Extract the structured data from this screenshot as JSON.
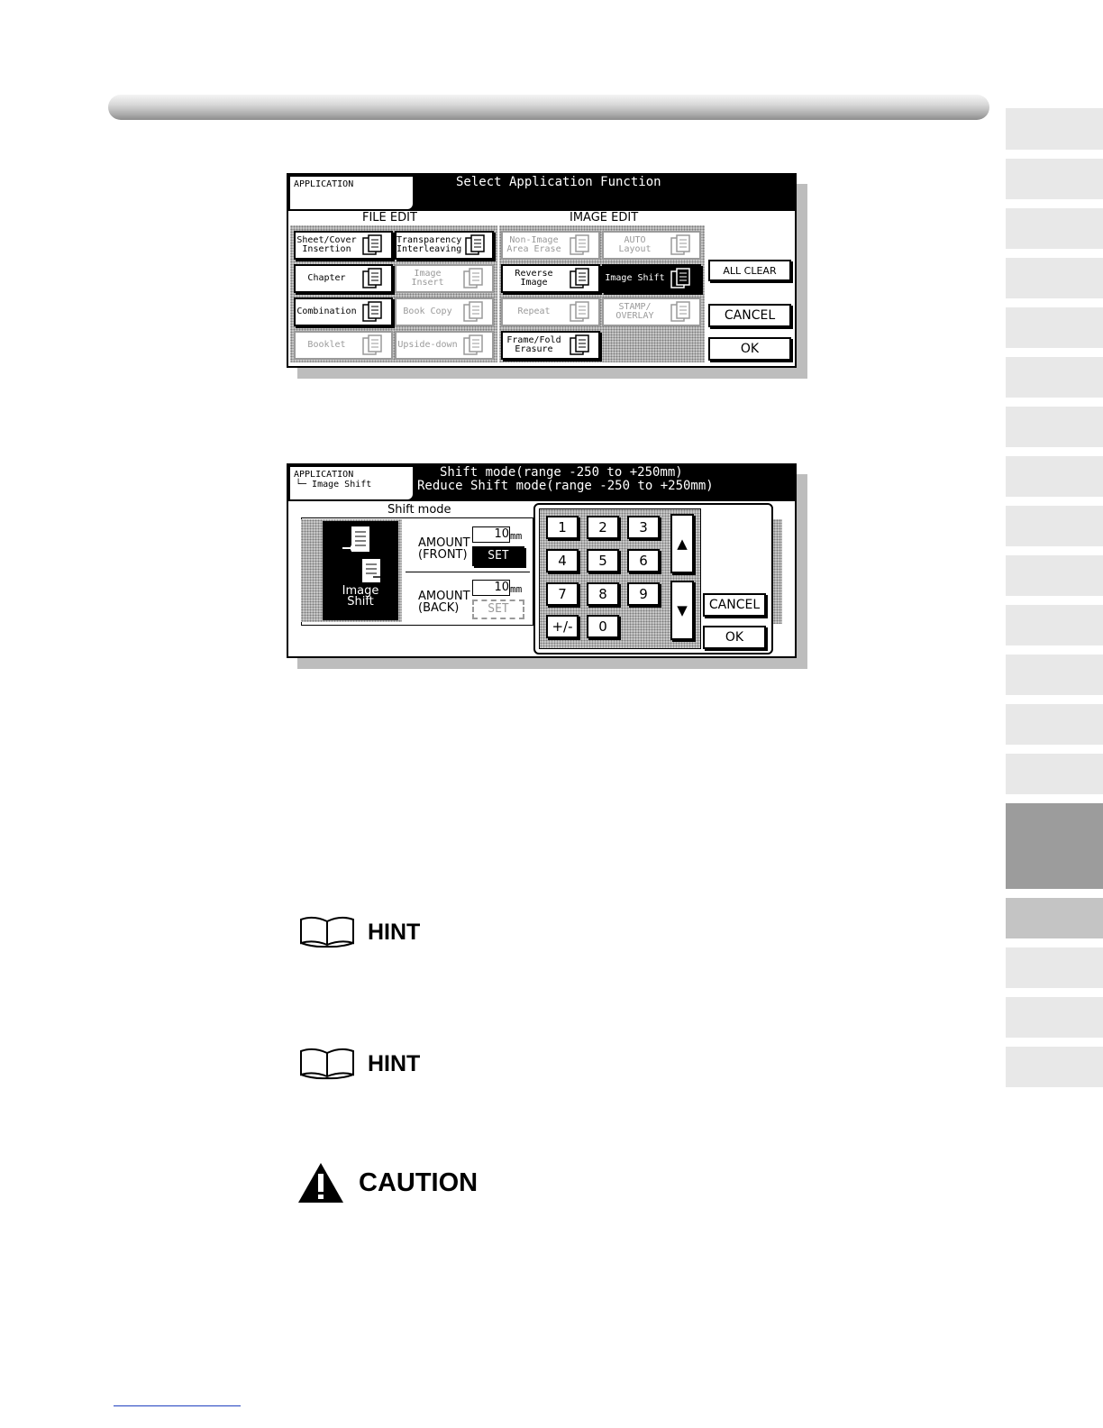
{
  "nav_tabs_count": 20,
  "screen1": {
    "app_label": "APPLICATION",
    "title": "Select Application Function",
    "file_edit_label": "FILE EDIT",
    "image_edit_label": "IMAGE EDIT",
    "file_buttons": [
      {
        "label": "Sheet/Cover\nInsertion",
        "icon": "sheets-stack-icon",
        "enabled": true
      },
      {
        "label": "Transparency\nInterleaving",
        "icon": "transparency-icon",
        "enabled": true
      },
      {
        "label": "Chapter",
        "icon": "chapter-pages-icon",
        "enabled": true
      },
      {
        "label": "Image\nInsert",
        "icon": "image-insert-icon",
        "enabled": false
      },
      {
        "label": "Combination",
        "icon": "combination-grid-icon",
        "enabled": true
      },
      {
        "label": "Book Copy",
        "icon": "book-copy-icon",
        "enabled": false
      },
      {
        "label": "Booklet",
        "icon": "booklet-icon",
        "enabled": false
      },
      {
        "label": "Upside-down",
        "icon": "upside-down-icon",
        "enabled": false
      }
    ],
    "image_buttons": [
      {
        "label": "Non-Image\nArea Erase",
        "icon": "area-erase-icon",
        "enabled": false
      },
      {
        "label": "AUTO\nLayout",
        "icon": "auto-layout-icon",
        "enabled": false
      },
      {
        "label": "Reverse\nImage",
        "icon": "reverse-image-icon",
        "enabled": true
      },
      {
        "label": "Image Shift",
        "icon": "image-shift-icon",
        "enabled": true,
        "selected": true
      },
      {
        "label": "Repeat",
        "icon": "repeat-icon",
        "enabled": false
      },
      {
        "label": "STAMP/\nOVERLAY",
        "icon": "stamp-icon",
        "enabled": false
      },
      {
        "label": "Frame/Fold\nErasure",
        "icon": "frame-erase-icon",
        "enabled": true
      }
    ],
    "all_clear": "ALL CLEAR",
    "cancel": "CANCEL",
    "ok": "OK"
  },
  "screen2": {
    "app_label": "APPLICATION",
    "breadcrumb": "└─ Image Shift",
    "title_line1": "Shift mode(range -250 to +250mm)",
    "title_line2": "Reduce Shift mode(range -250 to +250mm)",
    "mode_label": "Shift mode",
    "image_shift_label": "Image\nShift",
    "front_label": "AMOUNT\n(FRONT)",
    "front_value": "10",
    "back_label": "AMOUNT\n(BACK)",
    "back_value": "10",
    "unit": "mm",
    "set_label": "SET",
    "keys": [
      "1",
      "2",
      "3",
      "4",
      "5",
      "6",
      "7",
      "8",
      "9",
      "+/-",
      "0"
    ],
    "up_arrow": "▲",
    "down_arrow": "▼",
    "cancel": "CANCEL",
    "ok": "OK"
  },
  "hints": [
    "HINT",
    "HINT"
  ],
  "caution": "CAUTION"
}
